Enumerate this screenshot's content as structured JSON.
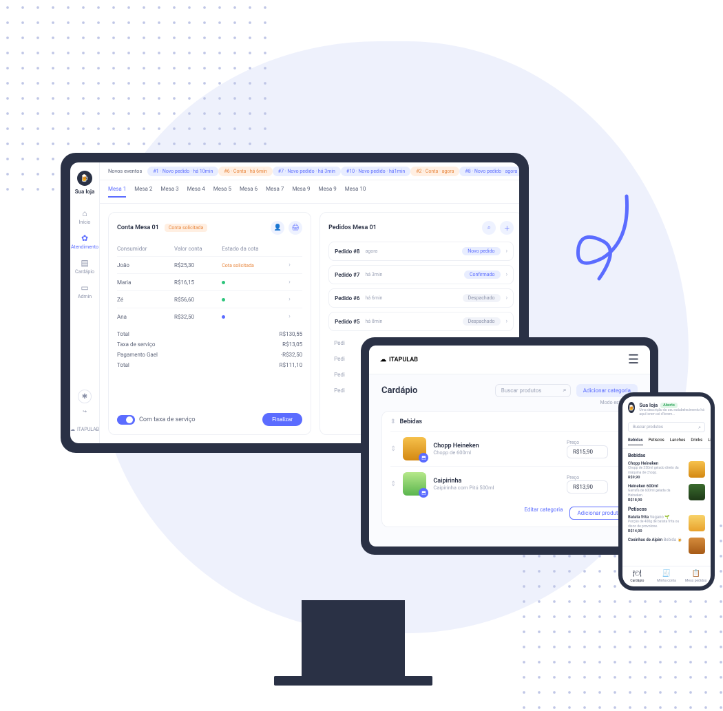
{
  "brand": "ITAPULAB",
  "store_label": "Sua loja",
  "sidebar": {
    "items": [
      {
        "label": "Início",
        "icon": "⌂"
      },
      {
        "label": "Atendimento",
        "icon": "✿"
      },
      {
        "label": "Cardápio",
        "icon": "▤"
      },
      {
        "label": "Admin",
        "icon": "▭"
      }
    ],
    "theme_icon": "✱",
    "logout_icon": "↪",
    "footer": "ITAPULAB"
  },
  "events": {
    "label": "Novos eventos",
    "pills": [
      {
        "text": "#1 · Novo pedido · há 10min",
        "tone": "blue"
      },
      {
        "text": "#6 · Conta · há 6min",
        "tone": "orange"
      },
      {
        "text": "#7 · Novo pedido · há 3min",
        "tone": "blue"
      },
      {
        "text": "#10 · Novo pedido · há1min",
        "tone": "blue"
      },
      {
        "text": "#2 · Conta · agora",
        "tone": "orange"
      },
      {
        "text": "#8 · Novo pedido · agora",
        "tone": "blue"
      }
    ]
  },
  "tabs": [
    "Mesa 1",
    "Mesa 2",
    "Mesa 3",
    "Mesa 4",
    "Mesa 5",
    "Mesa 6",
    "Mesa 7",
    "Mesa 9",
    "Mesa 9",
    "Mesa 10"
  ],
  "bill": {
    "title": "Conta Mesa 01",
    "badge": "Conta solicitada",
    "cols": {
      "consumer": "Consumidor",
      "value": "Valor conta",
      "status": "Estado da cota"
    },
    "rows": [
      {
        "name": "João",
        "value": "R$25,30",
        "status": "Cota solicitada",
        "status_type": "text"
      },
      {
        "name": "Maria",
        "value": "R$16,15",
        "status_type": "green"
      },
      {
        "name": "Zé",
        "value": "R$56,60",
        "status_type": "green"
      },
      {
        "name": "Ana",
        "value": "R$32,50",
        "status_type": "blue"
      }
    ],
    "totals": [
      {
        "label": "Total",
        "value": "R$130,55"
      },
      {
        "label": "Taxa de serviço",
        "value": "R$13,05"
      },
      {
        "label": "Pagamento Gael",
        "value": "-R$32,50"
      },
      {
        "label": "Total",
        "value": "R$111,10"
      }
    ],
    "toggle_label": "Com taxa de serviço",
    "finalize": "Finalizar"
  },
  "orders": {
    "title": "Pedidos Mesa 01",
    "rows": [
      {
        "id": "Pedido #8",
        "time": "agora",
        "status": "Novo pedido",
        "tone": "blue"
      },
      {
        "id": "Pedido #7",
        "time": "há 3min",
        "status": "Confirmado",
        "tone": "blue"
      },
      {
        "id": "Pedido #6",
        "time": "há 6min",
        "status": "Despachado",
        "tone": "gray"
      },
      {
        "id": "Pedido #5",
        "time": "há 8min",
        "status": "Despachado",
        "tone": "gray"
      }
    ],
    "stub": "Pedi"
  },
  "tablet": {
    "brand": "ITAPULAB",
    "title": "Cardápio",
    "search_placeholder": "Buscar produtos",
    "add_category": "Adicionar categoria",
    "mode_label": "Modo estoque",
    "category": "Bebidas",
    "products": [
      {
        "name": "Chopp Heineken",
        "desc": "Chopp de 600ml",
        "price_label": "Preço",
        "price": "R$15,90",
        "img": "beer"
      },
      {
        "name": "Caipirinha",
        "desc": "Caipirinha com Pitú 500ml",
        "price_label": "Preço",
        "price": "R$13,90",
        "img": "caip"
      }
    ],
    "edit_category": "Editar categoria",
    "add_product": "Adicionar produto"
  },
  "phone": {
    "store": "Sua loja",
    "open_badge": "Aberto",
    "subtitle": "Uma descrição do seu estabelecimento há aqui lorem só d'lorem...",
    "search_placeholder": "Buscar produtos",
    "tabs": [
      "Bebidas",
      "Petiscos",
      "Lanches",
      "Drinks",
      "Lic"
    ],
    "sections": [
      {
        "title": "Bebidas",
        "items": [
          {
            "name": "Chopp Heineken",
            "desc": "Chopp de 350ml gelado direto da máquina de chopp.",
            "price": "R$9,90",
            "thumb": "beer"
          },
          {
            "name": "Heineken 600ml",
            "desc": "Garrafa de 600ml gelada da Heineken.",
            "price": "R$18,90",
            "thumb": "bottle"
          }
        ]
      },
      {
        "title": "Petiscos",
        "items": [
          {
            "name": "Batata frita",
            "desc": "Porção de 400g de batata frita ou disco de provolone.",
            "price": "R$14,00",
            "tag": "Vegano 🌱",
            "thumb": "fries"
          },
          {
            "name": "Coxinhas de Aipim",
            "desc": "",
            "price": "",
            "tag": "Bebida 🍺",
            "thumb": "cox"
          }
        ]
      }
    ],
    "nav": [
      {
        "label": "Cardápio",
        "icon": "🍽"
      },
      {
        "label": "Minha conta",
        "icon": "🧾"
      },
      {
        "label": "Meus pedidos",
        "icon": "📋"
      }
    ]
  }
}
